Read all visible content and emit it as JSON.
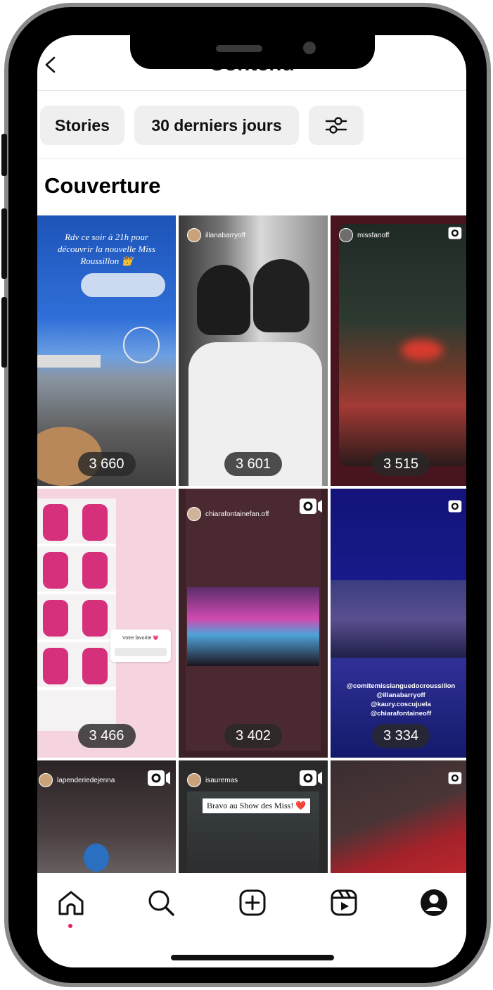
{
  "header": {
    "title": "Contenu"
  },
  "filters": {
    "type_chip": "Stories",
    "period_chip": "30 derniers jours"
  },
  "section": {
    "title": "Couverture"
  },
  "grid": {
    "tiles": [
      {
        "count": "3 660",
        "caption": "Rdv ce soir à 21h pour découvrir la nouvelle Miss Roussillon 👑"
      },
      {
        "count": "3 601",
        "username": "illanabarryoff"
      },
      {
        "count": "3 515",
        "username": "missfanoff"
      },
      {
        "count": "3 466",
        "poll_title": "Votre favorite 💗"
      },
      {
        "count": "3 402",
        "username": "chiarafontainefan.off"
      },
      {
        "count": "3 334",
        "mentions": [
          "@comitemisslanguedocroussillon",
          "@illanabarryoff",
          "@kaury.coscujuela",
          "@chiarafontaineoff"
        ]
      },
      {
        "username": "lapenderiedejenna"
      },
      {
        "username": "isauremas",
        "caption": "Bravo au Show des Miss! ❤️"
      },
      {}
    ]
  },
  "nav": {
    "items": [
      "home-icon",
      "search-icon",
      "create-icon",
      "reels-icon",
      "profile-icon"
    ]
  },
  "colors": {
    "accent_dot": "#e0245e",
    "chip_bg": "#efefef"
  }
}
